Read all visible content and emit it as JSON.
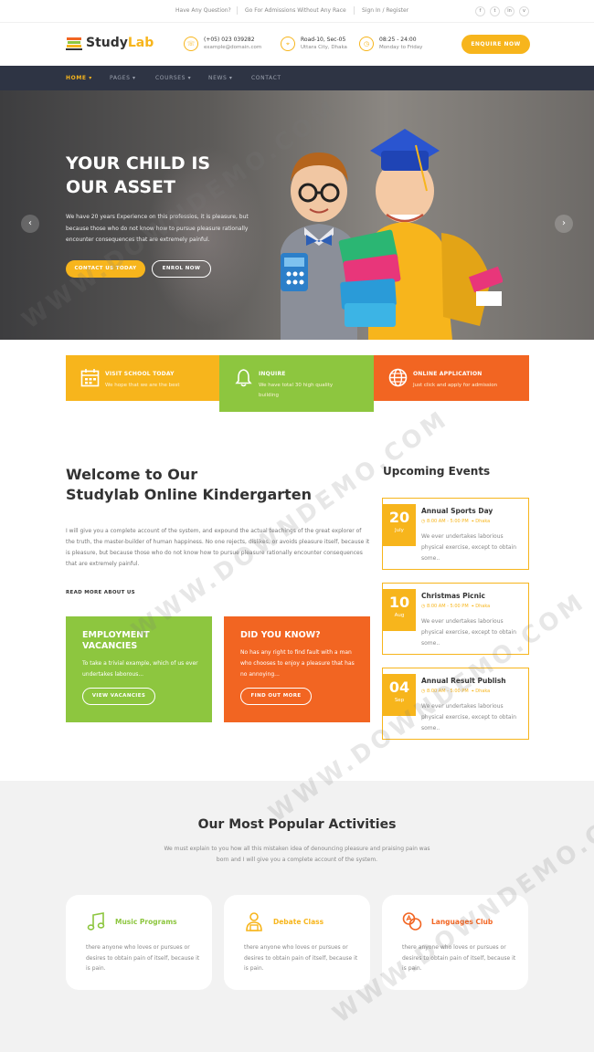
{
  "topbar": {
    "question": "Have Any Question?",
    "admissions": "Go For Admissions Without Any Race",
    "signin": "Sign In / Register",
    "social": [
      "f",
      "t",
      "in",
      "v"
    ]
  },
  "header": {
    "logo_study": "Study",
    "logo_lab": "Lab",
    "contact": {
      "line1": "(+05) 023 039282",
      "line2": "example@domain.com",
      "icon": "phone-icon"
    },
    "address": {
      "line1": "Road-10, Sec-05",
      "line2": "Uttara City, Dhaka",
      "icon": "location-icon"
    },
    "hours": {
      "line1": "08:25 - 24:00",
      "line2": "Monday to Friday",
      "icon": "clock-icon"
    },
    "enquire_label": "ENQUIRE NOW"
  },
  "nav": {
    "items": [
      "HOME",
      "PAGES",
      "COURSES",
      "NEWS",
      "CONTACT"
    ],
    "active_index": 0
  },
  "hero": {
    "title_line1": "YOUR CHILD IS",
    "title_line2": "OUR ASSET",
    "text": "We have 20 years Experience on this professios, it is pleasure, but because those who do not know how to pursue pleasure rationally encounter consequences that are extremely painful.",
    "btn_contact": "CONTACT US TODAY",
    "btn_enrol": "ENROL NOW",
    "prev": "‹",
    "next": "›"
  },
  "features": [
    {
      "title": "VISIT SCHOOL TODAY",
      "text": "We hope that we are the best",
      "color": "#f7b51c",
      "icon": "calendar-icon"
    },
    {
      "title": "INQUIRE",
      "text": "We have total 30 high quality building",
      "color": "#8dc63f",
      "icon": "bell-icon"
    },
    {
      "title": "ONLINE APPLICATION",
      "text": "Just click and apply for admission",
      "color": "#f26522",
      "icon": "globe-icon"
    }
  ],
  "welcome": {
    "title_line1": "Welcome to Our",
    "title_line2": "Studylab Online Kindergarten",
    "text": "I will give you a complete account of the system, and expound the actual teachings of the great explorer of the truth, the master-builder of human happiness. No one rejects, dislikes, or avoids pleasure itself, because it is pleasure, but because those who do not know how to pursue pleasure rationally encounter consequences that are extremely painful.",
    "read_more": "READ MORE ABOUT US"
  },
  "cards": [
    {
      "title_line1": "EMPLOYMENT",
      "title_line2": "VACANCIES",
      "text": "To take a trivial example, which of us ever undertakes laborous...",
      "button": "VIEW VACANCIES",
      "color": "#8dc63f"
    },
    {
      "title_line1": "DID YOU KNOW?",
      "title_line2": "",
      "text": "No has any right to find fault with a man who chooses to enjoy a pleasure that has no annoying...",
      "button": "FIND OUT MORE",
      "color": "#f26522"
    }
  ],
  "events": {
    "heading": "Upcoming Events",
    "items": [
      {
        "day": "20",
        "month": "July",
        "title": "Annual Sports Day",
        "time": "8:00 AM - 5:00 PM",
        "place": "Dhaka",
        "text": "We ever undertakes laborious physical exercise, except to obtain some.."
      },
      {
        "day": "10",
        "month": "Aug",
        "title": "Christmas Picnic",
        "time": "8:00 AM - 5:00 PM",
        "place": "Dhaka",
        "text": "We ever undertakes laborious physical exercise, except to obtain some.."
      },
      {
        "day": "04",
        "month": "Sep",
        "title": "Annual Result Publish",
        "time": "8:00 AM - 5:00 PM",
        "place": "Dhaka",
        "text": "We ever undertakes laborious physical exercise, except to obtain some.."
      }
    ]
  },
  "activities": {
    "heading": "Our Most Popular Activities",
    "text": "We must explain to you how all this mistaken idea of denouncing pleasure and praising pain was born and I will give you a complete account of the system.",
    "items": [
      {
        "title": "Music Programs",
        "text": "there anyone who loves or pursues or desires to obtain pain of itself, because it is pain.",
        "color": "#8dc63f",
        "icon": "music-icon"
      },
      {
        "title": "Debate Class",
        "text": "there anyone who loves or pursues or desires to obtain pain of itself, because it is pain.",
        "color": "#f7b51c",
        "icon": "debate-icon"
      },
      {
        "title": "Languages Club",
        "text": "there anyone who loves or pursues or desires to obtain pain of itself, because it is pain.",
        "color": "#f26522",
        "icon": "languages-icon"
      }
    ]
  },
  "watermark": "WWW.DOWNDEMO.COM"
}
